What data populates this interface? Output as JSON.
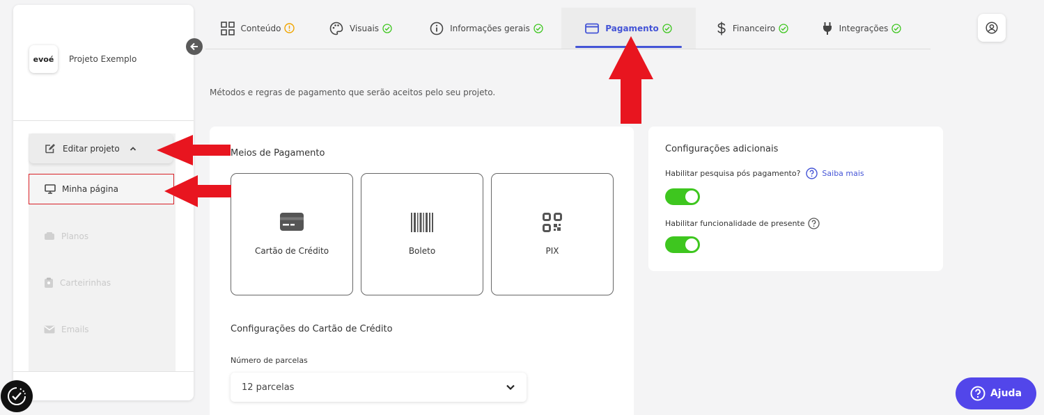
{
  "sidebar": {
    "logo_text": "evoé",
    "project_name": "Projeto Exemplo",
    "edit_project_label": "Editar projeto",
    "items": [
      {
        "label": "Minha página",
        "icon": "monitor-icon",
        "state": "active"
      },
      {
        "label": "Planos",
        "icon": "layers-icon",
        "state": "disabled"
      },
      {
        "label": "Carteirinhas",
        "icon": "id-badge-icon",
        "state": "disabled"
      },
      {
        "label": "Emails",
        "icon": "envelope-icon",
        "state": "disabled"
      }
    ]
  },
  "tabs": [
    {
      "label": "Conteúdo",
      "icon": "grid-icon",
      "status": "warning"
    },
    {
      "label": "Visuais",
      "icon": "palette-icon",
      "status": "ok"
    },
    {
      "label": "Informações gerais",
      "icon": "info-icon",
      "status": "ok"
    },
    {
      "label": "Pagamento",
      "icon": "credit-card-icon",
      "status": "ok",
      "active": true
    },
    {
      "label": "Financeiro",
      "icon": "dollar-icon",
      "status": "ok"
    },
    {
      "label": "Integrações",
      "icon": "plug-icon",
      "status": "ok"
    }
  ],
  "page": {
    "description": "Métodos e regras de pagamento que serão aceitos pelo seu projeto."
  },
  "payment": {
    "methods_title": "Meios de Pagamento",
    "methods": [
      {
        "label": "Cartão de Crédito",
        "icon": "credit-card-icon"
      },
      {
        "label": "Boleto",
        "icon": "barcode-icon"
      },
      {
        "label": "PIX",
        "icon": "qr-code-icon"
      }
    ],
    "card_settings_title": "Configurações do Cartão de Crédito",
    "installments_label": "Número de parcelas",
    "installments_value": "12 parcelas"
  },
  "additional": {
    "title": "Configurações adicionais",
    "survey_label": "Habilitar pesquisa pós pagamento?",
    "learn_more": "Saiba mais",
    "survey_enabled": true,
    "gift_label": "Habilitar funcionalidade de presente",
    "gift_enabled": true
  },
  "help": {
    "label": "Ajuda"
  },
  "colors": {
    "accent": "#4454d6",
    "help_button": "#5246ea",
    "toggle_on": "#3ec61f",
    "warning": "#f0a500",
    "ok": "#3ec61f",
    "annotation": "#e8151f"
  }
}
